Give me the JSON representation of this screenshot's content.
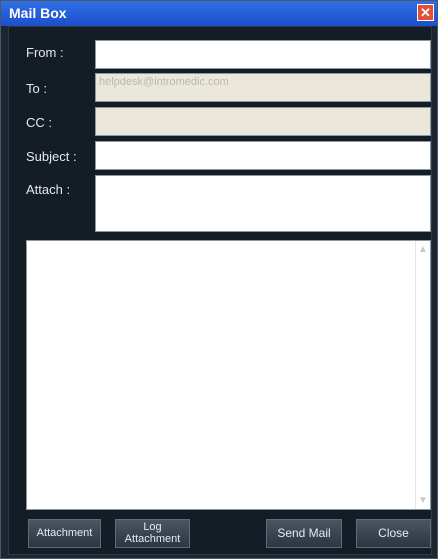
{
  "window": {
    "title": "Mail Box"
  },
  "form": {
    "from_label": "From :",
    "from_value": "",
    "to_label": "To :",
    "to_value": "helpdesk@intromedic.com",
    "cc_label": "CC :",
    "cc_value": "",
    "subject_label": "Subject :",
    "subject_value": "",
    "attach_label": "Attach :",
    "attach_value": ""
  },
  "body": {
    "text": ""
  },
  "buttons": {
    "attachment": "Attachment",
    "log_attachment_line1": "Log",
    "log_attachment_line2": "Attachment",
    "send_mail": "Send Mail",
    "close": "Close"
  },
  "icons": {
    "close": "close-icon",
    "scroll_up": "scroll-up-icon",
    "scroll_down": "scroll-down-icon"
  }
}
